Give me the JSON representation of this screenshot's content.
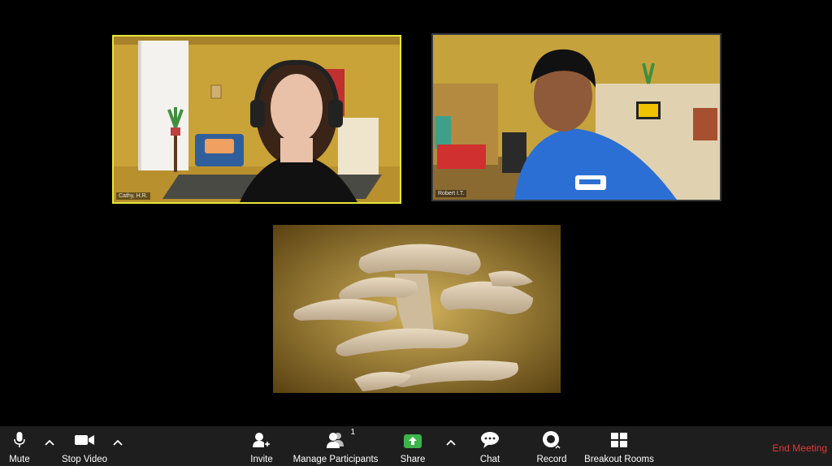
{
  "participants": {
    "cathy": {
      "name": "Cathy, H.R."
    },
    "robert": {
      "name": "Robert I.T."
    }
  },
  "share": {
    "description": "oyster mushrooms"
  },
  "toolbar": {
    "mute": "Mute",
    "stop_video": "Stop Video",
    "invite": "Invite",
    "manage_participants": "Manage Participants",
    "participant_count": "1",
    "share": "Share",
    "chat": "Chat",
    "record": "Record",
    "breakout_rooms": "Breakout Rooms",
    "end_meeting": "End Meeting"
  },
  "colors": {
    "active_speaker": "#e6e63a",
    "share_green": "#3bb54a",
    "end_red": "#e53935"
  },
  "icons": [
    "microphone-icon",
    "caret-up-icon",
    "video-camera-icon",
    "invite-icon",
    "participants-icon",
    "share-screen-icon",
    "chat-icon",
    "record-icon",
    "breakout-rooms-icon"
  ]
}
